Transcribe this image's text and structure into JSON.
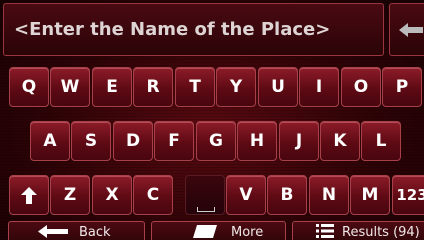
{
  "search": {
    "placeholder": "<Enter the Name of the Place>"
  },
  "keyboard": {
    "row1": [
      "Q",
      "W",
      "E",
      "R",
      "T",
      "Y",
      "U",
      "I",
      "O",
      "P"
    ],
    "row2": [
      "A",
      "S",
      "D",
      "F",
      "G",
      "H",
      "J",
      "K",
      "L"
    ],
    "row3": [
      "Z",
      "X",
      "C",
      "V",
      "B",
      "N",
      "M"
    ],
    "numbers_label": "123"
  },
  "bottom_bar": {
    "back_label": "Back",
    "more_label": "More",
    "results_label": "Results (94)"
  },
  "colors": {
    "background": "#2e0306",
    "key": "#6e0f1a",
    "key_border": "#a8404a",
    "text": "#ffffff"
  },
  "icons": {
    "backspace": "arrow-left-icon",
    "shift": "shift-up-arrow-icon",
    "space": "space-bar-icon",
    "back": "arrow-left-icon",
    "more": "more-menu-icon",
    "results": "list-icon"
  }
}
